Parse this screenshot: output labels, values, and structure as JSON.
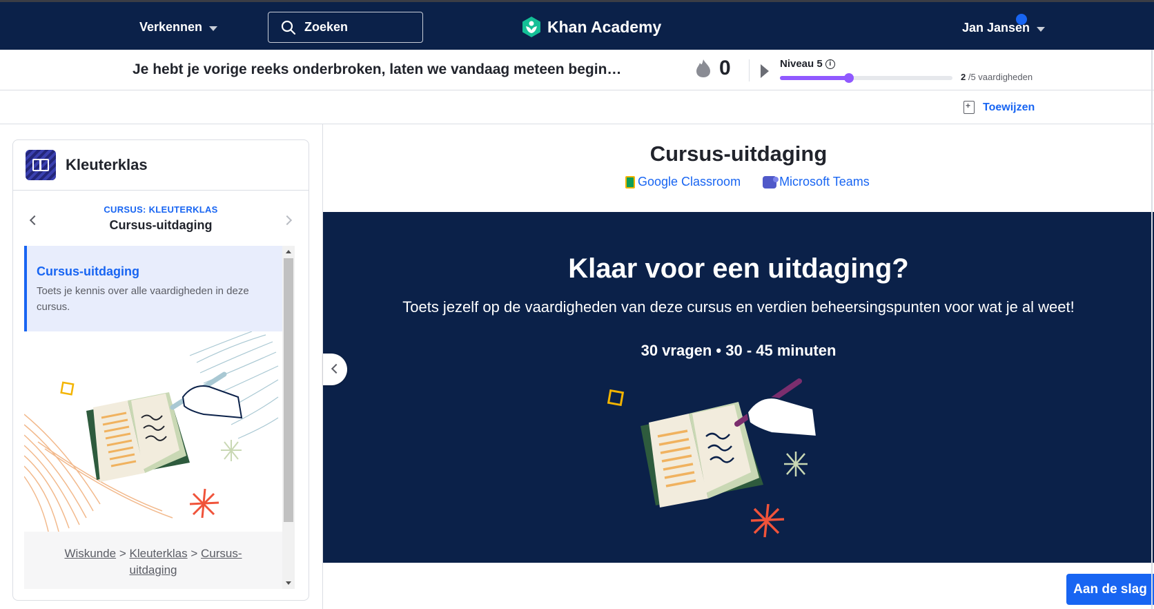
{
  "nav": {
    "explore_label": "Verkennen",
    "search_placeholder": "Zoeken",
    "logo_text": "Khan Academy",
    "user_name": "Jan Jansen"
  },
  "streak": {
    "message": "Je hebt je vorige reeks onderbroken, laten we vandaag meteen begin…",
    "count": "0",
    "level_label": "Niveau 5",
    "skills_done": "2",
    "skills_total": " /5 vaardigheden",
    "progress_fraction": 0.4
  },
  "assign_label": "Toewijzen",
  "sidebar": {
    "course_title": "Kleuterklas",
    "crumb_label": "CURSUS: KLEUTERKLAS",
    "crumb_title": "Cursus-uitdaging",
    "item_title": "Cursus-uitdaging",
    "item_desc": "Toets je kennis over alle vaardigheden in deze cursus.",
    "breadcrumb": {
      "level1": "Wiskunde",
      "level2": "Kleuterklas",
      "level3a": "Cursus-",
      "level3b": "uitdaging",
      "sep": ">"
    }
  },
  "main": {
    "title": "Cursus-uitdaging",
    "share_google": "Google Classroom",
    "share_teams": "Microsoft Teams",
    "hero_title": "Klaar voor een uitdaging?",
    "hero_subtitle": "Toets jezelf op de vaardigheden van deze cursus en verdien beheersingspunten voor wat je al weet!",
    "hero_meta": "30 vragen • 30 - 45 minuten",
    "start_button": "Aan de slag"
  },
  "colors": {
    "navy": "#0b2149",
    "blue": "#1865f2",
    "purple": "#9059ff"
  }
}
